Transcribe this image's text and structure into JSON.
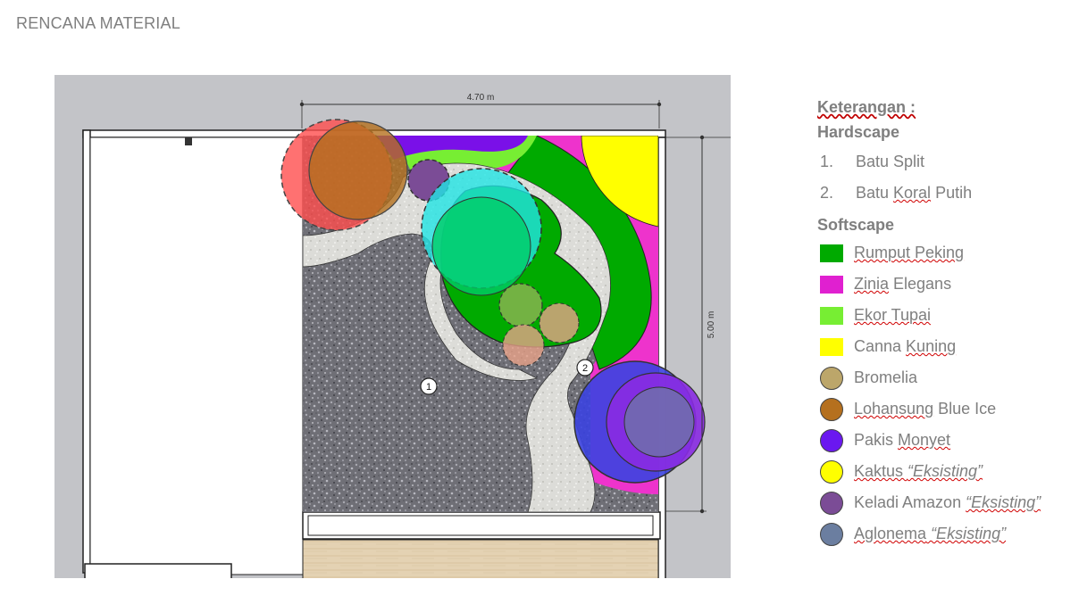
{
  "title": "RENCANA MATERIAL",
  "plan": {
    "dim_width": "4.70 m",
    "dim_height": "5.00 m",
    "marker_1": "1",
    "marker_2": "2"
  },
  "legend": {
    "heading": "Keterangan :",
    "hardscape_title": "Hardscape",
    "hardscape": [
      {
        "num": "1.",
        "label": "Batu Split"
      },
      {
        "num": "2.",
        "label_a": "Batu ",
        "label_b": "Koral",
        "label_c": " Putih"
      }
    ],
    "softscape_title": "Softscape",
    "softscape": [
      {
        "shape": "square",
        "color": "#00aa00",
        "a": "Rumput",
        "b": " Peking",
        "c": ""
      },
      {
        "shape": "square",
        "color": "#e020d0",
        "a": "Zinia",
        "b": " Elegans",
        "c": ""
      },
      {
        "shape": "square",
        "color": "#77ee33",
        "a": "Ekor Tupai",
        "b": "",
        "c": ""
      },
      {
        "shape": "square",
        "color": "#ffff00",
        "a": "Canna ",
        "b": "Kuning",
        "c": ""
      },
      {
        "shape": "circle",
        "color": "#bca66a",
        "a": "Bromelia",
        "b": "",
        "c": ""
      },
      {
        "shape": "circle",
        "color": "#b5701e",
        "a": "Lohansung",
        "b": " Blue Ice",
        "c": ""
      },
      {
        "shape": "circle",
        "color": "#6a18f0",
        "a": "Pakis ",
        "b": "Monyet",
        "c": ""
      },
      {
        "shape": "circle",
        "color": "#ffff00",
        "a": "Kaktus ",
        "b": "“Eksisting”",
        "c": ""
      },
      {
        "shape": "circle",
        "color": "#7b4c96",
        "a": "Keladi Amazon ",
        "b": "“Eksisting”",
        "c": ""
      },
      {
        "shape": "circle",
        "color": "#6b7ea0",
        "a": "Aglonema",
        "b": " “Eksisting”",
        "c": ""
      }
    ]
  }
}
